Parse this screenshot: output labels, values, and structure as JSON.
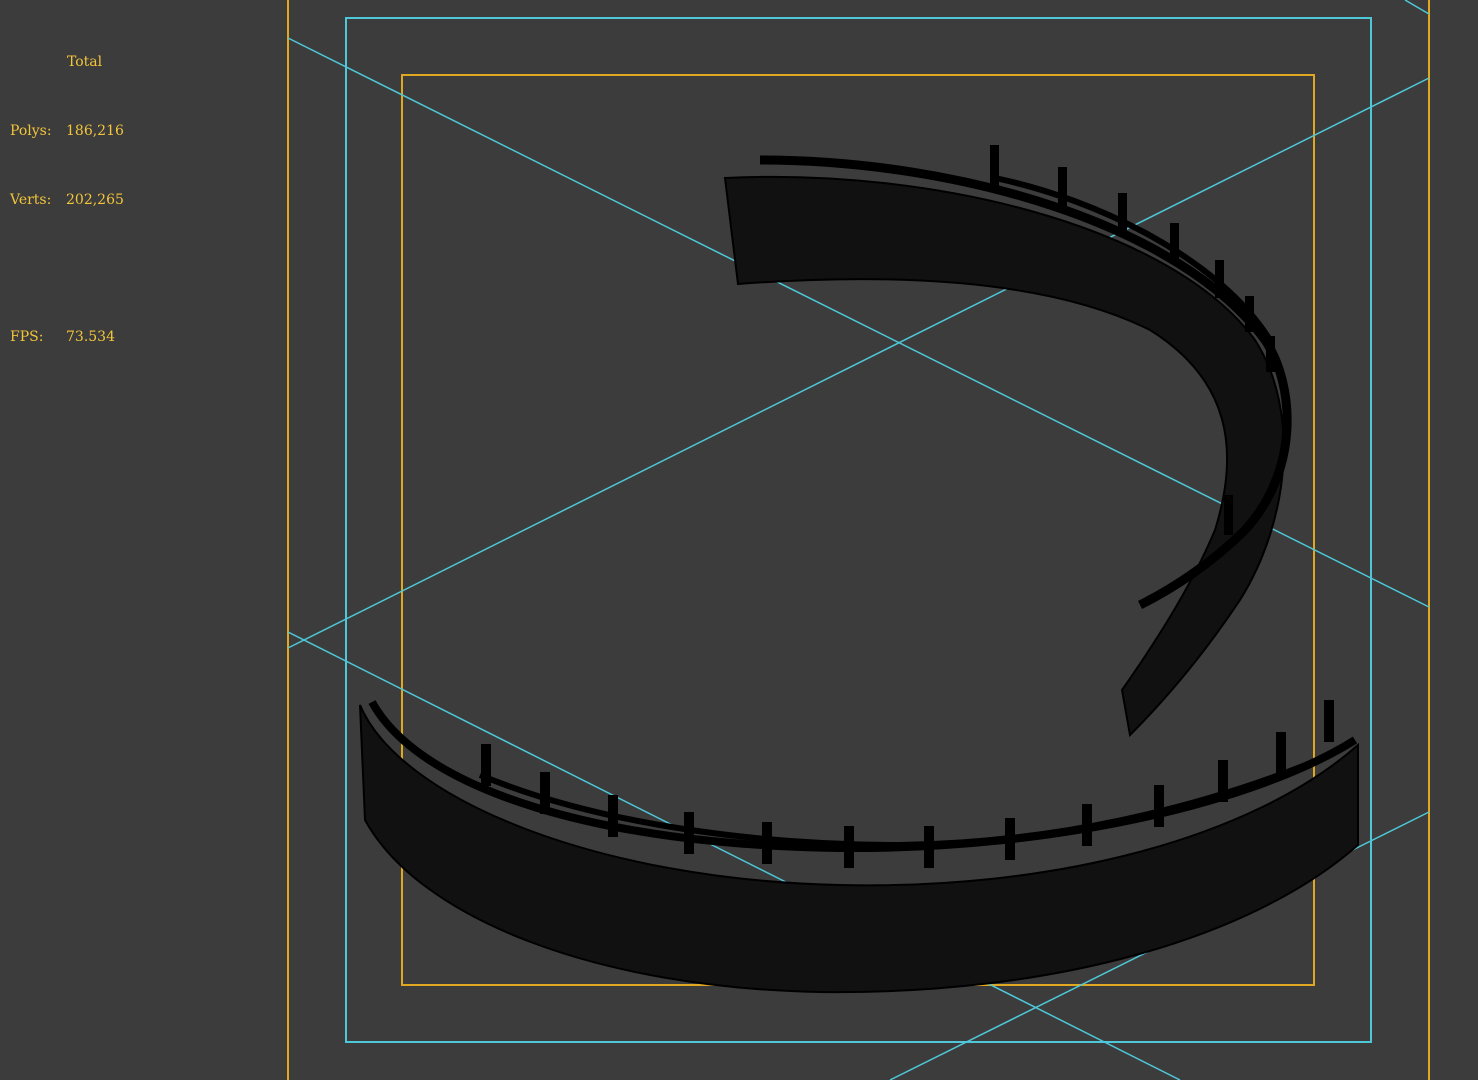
{
  "viewport": {
    "background": "#3c3c3c",
    "safe_frame_color": "#e0a820",
    "action_safe_color": "#4ec8d8",
    "wireframe_color": "#0a0a0a"
  },
  "stats": {
    "color": "#f2c53a",
    "title": "Total",
    "polys_label": "Polys:",
    "polys_value": "186,216",
    "verts_label": "Verts:",
    "verts_value": "202,265",
    "fps_label": "FPS:",
    "fps_value": "73.534"
  }
}
